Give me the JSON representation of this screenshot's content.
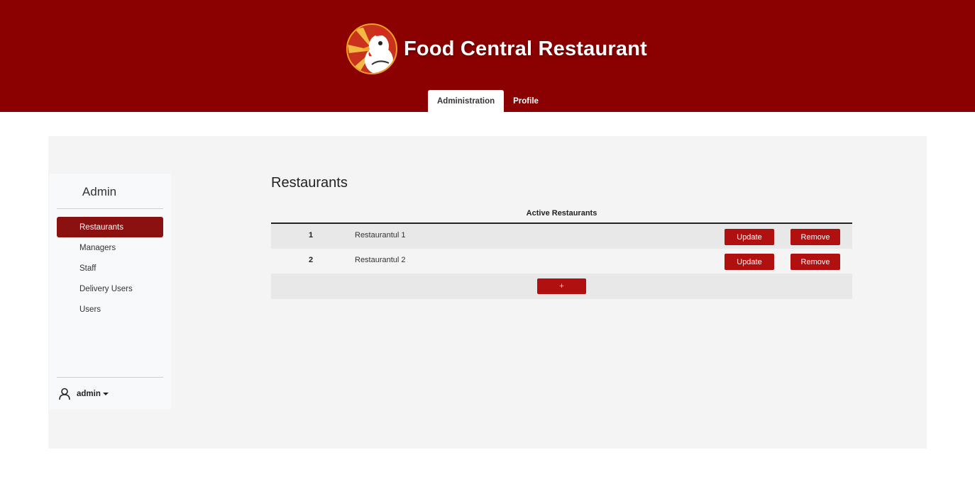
{
  "header": {
    "brand_title": "Food Central Restaurant",
    "logo_icon": "rooster-mascot-icon",
    "background_color": "#8b0000"
  },
  "tabs": [
    {
      "label": "Administration",
      "active": true
    },
    {
      "label": "Profile",
      "active": false
    }
  ],
  "sidebar": {
    "title": "Admin",
    "items": [
      {
        "label": "Restaurants",
        "active": true
      },
      {
        "label": "Managers",
        "active": false
      },
      {
        "label": "Staff",
        "active": false
      },
      {
        "label": "Delivery Users",
        "active": false
      },
      {
        "label": "Users",
        "active": false
      }
    ],
    "user": {
      "name": "admin",
      "icon": "user-icon"
    },
    "active_color": "#8b1010"
  },
  "main": {
    "title": "Restaurants",
    "table": {
      "heading": "Active Restaurants",
      "rows": [
        {
          "id": "1",
          "name": "Restaurantul 1",
          "update_label": "Update",
          "remove_label": "Remove"
        },
        {
          "id": "2",
          "name": "Restaurantul 2",
          "update_label": "Update",
          "remove_label": "Remove"
        }
      ],
      "add_label": "+"
    },
    "button_color": "#b01010"
  }
}
